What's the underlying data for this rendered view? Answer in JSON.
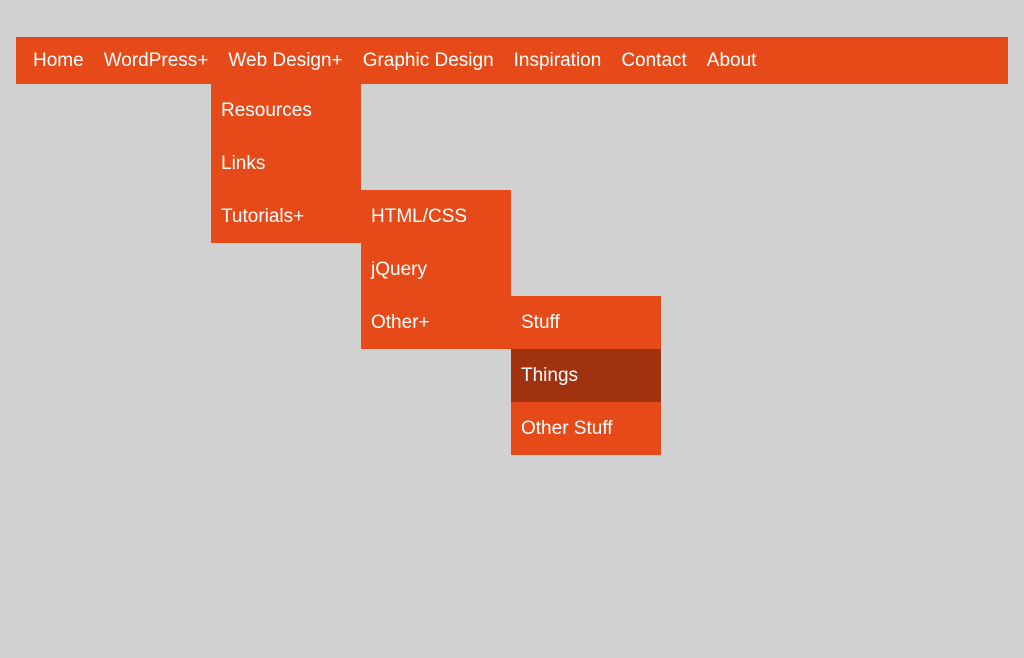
{
  "nav": {
    "items": [
      {
        "label": "Home",
        "hasChildren": false
      },
      {
        "label": "WordPress",
        "hasChildren": true
      },
      {
        "label": "Web Design",
        "hasChildren": true
      },
      {
        "label": "Graphic Design",
        "hasChildren": false
      },
      {
        "label": "Inspiration",
        "hasChildren": false
      },
      {
        "label": "Contact",
        "hasChildren": false
      },
      {
        "label": "About",
        "hasChildren": false
      }
    ]
  },
  "dropdown1": {
    "items": [
      {
        "label": "Resources",
        "hasChildren": false
      },
      {
        "label": "Links",
        "hasChildren": false
      },
      {
        "label": "Tutorials",
        "hasChildren": true
      }
    ]
  },
  "dropdown2": {
    "items": [
      {
        "label": "HTML/CSS",
        "hasChildren": false
      },
      {
        "label": "jQuery",
        "hasChildren": false
      },
      {
        "label": "Other",
        "hasChildren": true
      }
    ]
  },
  "dropdown3": {
    "items": [
      {
        "label": "Stuff",
        "hasChildren": false,
        "active": false
      },
      {
        "label": "Things",
        "hasChildren": false,
        "active": true
      },
      {
        "label": "Other Stuff",
        "hasChildren": false,
        "active": false
      }
    ]
  },
  "expandIndicator": " +"
}
